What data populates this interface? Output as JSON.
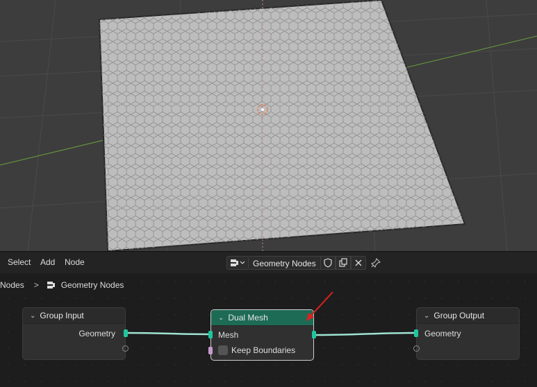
{
  "header": {
    "menu": [
      "Select",
      "Add",
      "Node"
    ],
    "tree_name": "Geometry Nodes"
  },
  "breadcrumb": {
    "parent": "Nodes",
    "current": "Geometry Nodes"
  },
  "nodes": {
    "group_input": {
      "title": "Group Input",
      "output": "Geometry"
    },
    "dual_mesh": {
      "title": "Dual Mesh",
      "input_mesh": "Mesh",
      "option": "Keep Boundaries"
    },
    "group_output": {
      "title": "Group Output",
      "input": "Geometry"
    }
  },
  "colors": {
    "geometry_socket": "#1fc7a0",
    "bool_socket": "#c79bd0",
    "dual_mesh_header": "#1e6b55",
    "annotation_arrow": "#e02020"
  }
}
